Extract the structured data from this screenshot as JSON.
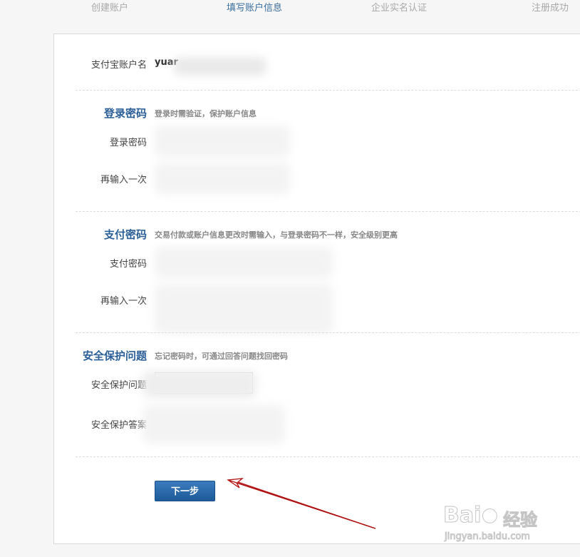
{
  "steps": [
    "创建账户",
    "填写账户信息",
    "企业实名认证",
    "注册成功"
  ],
  "active_step": "填写账户信息",
  "account": {
    "label": "支付宝账户名",
    "value_prefix": "yuar"
  },
  "login_password": {
    "title": "登录密码",
    "hint": "登录时需验证，保护账户信息",
    "field1_label": "登录密码",
    "field2_label": "再输入一次"
  },
  "pay_password": {
    "title": "支付密码",
    "hint": "交易付款或账户信息更改时需输入，与登录密码不一样，安全级别更高",
    "field1_label": "支付密码",
    "field2_label": "再输入一次"
  },
  "security": {
    "title": "安全保护问题",
    "hint": "忘记密码时，可通过回答问题找回密码",
    "question_label": "安全保护问题",
    "answer_label": "安全保护答案"
  },
  "next_button": "下一步",
  "watermark": {
    "brand": "Bai",
    "brand_suffix": "经验",
    "url": "jingyan.baidu.com"
  },
  "colors": {
    "accent": "#2c5f97",
    "button": "#1f5f9f",
    "arrow": "#b01010"
  }
}
